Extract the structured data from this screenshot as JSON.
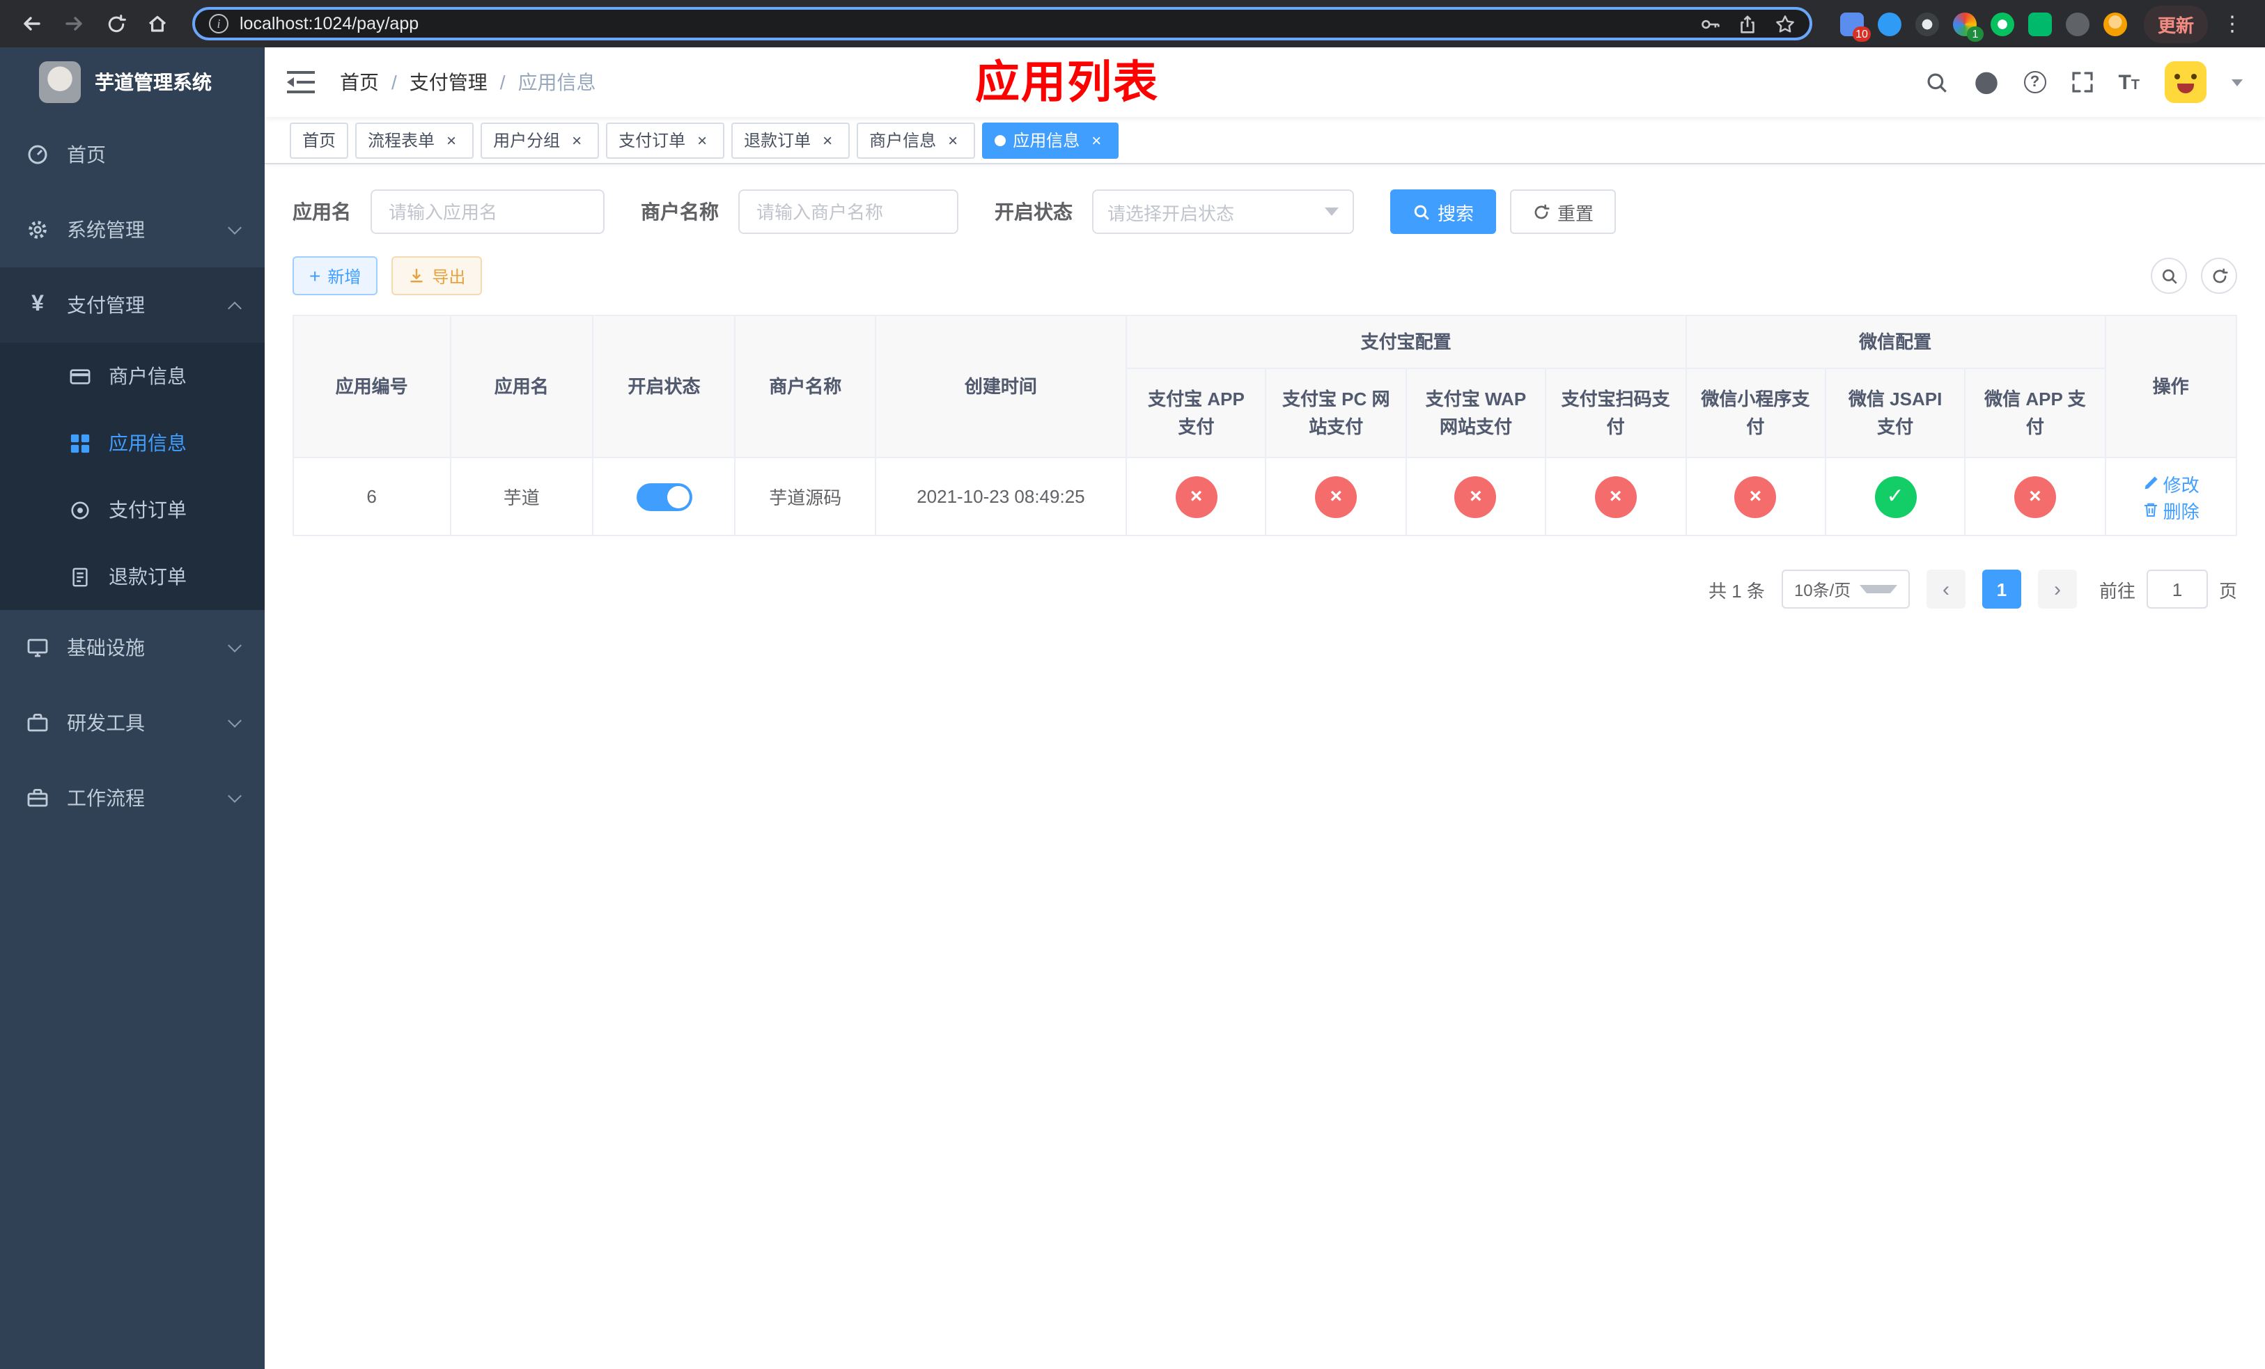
{
  "colors": {
    "primary": "#409eff",
    "success": "#13ce66",
    "danger": "#f56c6c",
    "warning": "#e6a23c",
    "annotation": "#ff0000",
    "sidebar_bg": "#304156",
    "submenu_bg": "#1f2d3d"
  },
  "browser": {
    "url": "localhost:1024/pay/app",
    "update_label": "更新",
    "extension_badge_first": "10",
    "extension_badge_fourth": "1"
  },
  "sidebar": {
    "title": "芋道管理系统",
    "home": "首页",
    "system": "系统管理",
    "payment": "支付管理",
    "merchant_info": "商户信息",
    "app_info": "应用信息",
    "pay_order": "支付订单",
    "refund_order": "退款订单",
    "infrastructure": "基础设施",
    "dev_tools": "研发工具",
    "workflow": "工作流程"
  },
  "header": {
    "breadcrumb": {
      "home": "首页",
      "section": "支付管理",
      "current": "应用信息"
    },
    "annotation": "应用列表"
  },
  "tabs": [
    {
      "label": "首页",
      "closable": false,
      "active": false
    },
    {
      "label": "流程表单",
      "closable": true,
      "active": false
    },
    {
      "label": "用户分组",
      "closable": true,
      "active": false
    },
    {
      "label": "支付订单",
      "closable": true,
      "active": false
    },
    {
      "label": "退款订单",
      "closable": true,
      "active": false
    },
    {
      "label": "商户信息",
      "closable": true,
      "active": false
    },
    {
      "label": "应用信息",
      "closable": true,
      "active": true
    }
  ],
  "filters": {
    "app_name_label": "应用名",
    "app_name_placeholder": "请输入应用名",
    "merchant_label": "商户名称",
    "merchant_placeholder": "请输入商户名称",
    "status_label": "开启状态",
    "status_placeholder": "请选择开启状态",
    "search_label": "搜索",
    "reset_label": "重置"
  },
  "toolbar": {
    "add_label": "新增",
    "export_label": "导出"
  },
  "table": {
    "col_id": "应用编号",
    "col_name": "应用名",
    "col_status": "开启状态",
    "col_merchant": "商户名称",
    "col_created": "创建时间",
    "group_alipay": "支付宝配置",
    "group_wechat": "微信配置",
    "col_alipay_app": "支付宝 APP 支付",
    "col_alipay_pc": "支付宝 PC 网站支付",
    "col_alipay_wap": "支付宝 WAP 网站支付",
    "col_alipay_qr": "支付宝扫码支付",
    "col_wx_mini": "微信小程序支付",
    "col_wx_jsapi": "微信 JSAPI 支付",
    "col_wx_app": "微信 APP 支付",
    "col_actions": "操作",
    "row": {
      "id": "6",
      "name": "芋道",
      "status_enabled": true,
      "merchant": "芋道源码",
      "created": "2021-10-23 08:49:25",
      "configs": [
        "no",
        "no",
        "no",
        "no",
        "no",
        "yes",
        "no"
      ],
      "edit_label": "修改",
      "delete_label": "删除"
    }
  },
  "pagination": {
    "total_label": "共 1 条",
    "page_size_label": "10条/页",
    "page": "1",
    "goto_label": "前往",
    "goto_value": "1",
    "unit_label": "页"
  }
}
